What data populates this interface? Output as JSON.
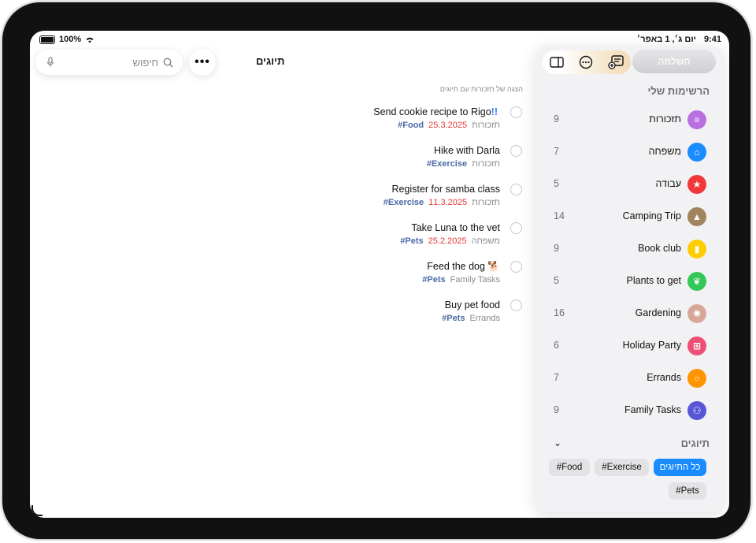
{
  "status": {
    "time": "9:41",
    "date": "יום ג׳, 1 באפר׳",
    "battery": "100%"
  },
  "toolbar": {
    "search_placeholder": "חיפוש",
    "more_label": "•••",
    "title": "תיוגים"
  },
  "main": {
    "subheader": "הצגה של תזכורות עם תיוגים",
    "reminders": [
      {
        "title": "Send cookie recipe to Rigo",
        "priority": "!!",
        "list": "תזכורות",
        "date": "25.3.2025",
        "tag": "#Food"
      },
      {
        "title": "Hike with Darla",
        "priority": "",
        "list": "תזכורות",
        "date": "",
        "tag": "#Exercise"
      },
      {
        "title": "Register for samba class",
        "priority": "",
        "list": "תזכורות",
        "date": "11.3.2025",
        "tag": "#Exercise"
      },
      {
        "title": "Take Luna to the vet",
        "priority": "",
        "list": "משפחה",
        "date": "25.2.2025",
        "tag": "#Pets"
      },
      {
        "title": "Feed the dog 🐕",
        "priority": "",
        "list": "Family Tasks",
        "date": "",
        "tag": "#Pets"
      },
      {
        "title": "Buy pet food",
        "priority": "",
        "list": "Errands",
        "date": "",
        "tag": "#Pets"
      }
    ]
  },
  "sidebar": {
    "done_label": "השלמה",
    "heading": "הרשימות שלי",
    "lists": [
      {
        "name": "תזכורות",
        "count": "9",
        "icon": "list-icon",
        "color": "#b86fe0",
        "glyph": "≡"
      },
      {
        "name": "משפחה",
        "count": "7",
        "icon": "house-icon",
        "color": "#1a8cff",
        "glyph": "⌂"
      },
      {
        "name": "עבודה",
        "count": "5",
        "icon": "star-icon",
        "color": "#f2383a",
        "glyph": "★"
      },
      {
        "name": "Camping Trip",
        "count": "14",
        "icon": "tent-icon",
        "color": "#a2845e",
        "glyph": "▲"
      },
      {
        "name": "Book club",
        "count": "9",
        "icon": "bookmark-icon",
        "color": "#ffcc00",
        "glyph": "▮"
      },
      {
        "name": "Plants to get",
        "count": "5",
        "icon": "leaf-icon",
        "color": "#34c759",
        "glyph": "❦"
      },
      {
        "name": "Gardening",
        "count": "16",
        "icon": "sun-icon",
        "color": "#d9a79a",
        "glyph": "✺"
      },
      {
        "name": "Holiday Party",
        "count": "6",
        "icon": "gift-icon",
        "color": "#ee4f74",
        "glyph": "⊞"
      },
      {
        "name": "Errands",
        "count": "7",
        "icon": "circle-icon",
        "color": "#ff9500",
        "glyph": "○"
      },
      {
        "name": "Family Tasks",
        "count": "9",
        "icon": "people-icon",
        "color": "#5856d6",
        "glyph": "⚇"
      }
    ],
    "tags_heading": "תיוגים",
    "tags": {
      "all": "כל התיוגים",
      "exercise": "#Exercise",
      "food": "#Food",
      "pets": "#Pets"
    }
  }
}
